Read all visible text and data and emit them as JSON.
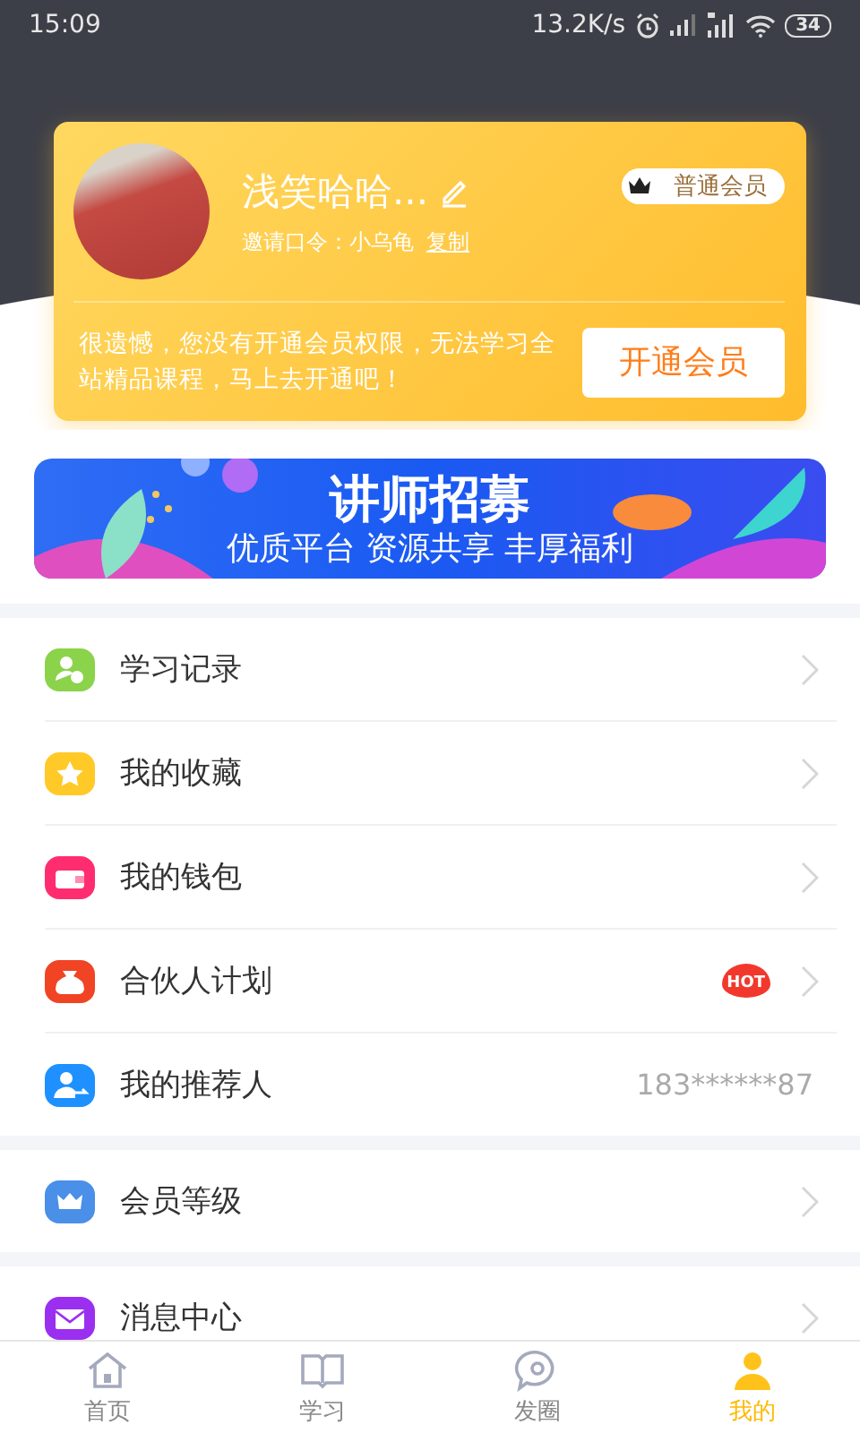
{
  "status_bar": {
    "time": "15:09",
    "speed": "13.2K/s",
    "battery": "34"
  },
  "profile_card": {
    "name": "浅笑哈哈...",
    "invite_label": "邀请口令：小乌龟",
    "copy_link": "复制",
    "member_badge": "普通会员",
    "notice": "很遗憾，您没有开通会员权限，无法学习全站精品课程，马上去开通吧！",
    "open_button": "开通会员"
  },
  "banner": {
    "title": "讲师招募",
    "subtitle": "优质平台 资源共享 丰厚福利"
  },
  "menu_groups": [
    {
      "items": [
        {
          "label": "学习记录",
          "kind": "person-plus",
          "color": "#8bd34a"
        },
        {
          "label": "我的收藏",
          "kind": "star",
          "color": "#ffc928"
        },
        {
          "label": "我的钱包",
          "kind": "wallet",
          "color": "#ff2d6f"
        },
        {
          "label": "合伙人计划",
          "kind": "bag",
          "color": "#f04424",
          "badge": "HOT"
        },
        {
          "label": "我的推荐人",
          "kind": "person-share",
          "color": "#1e90ff",
          "value": "183******87"
        }
      ]
    },
    {
      "items": [
        {
          "label": "会员等级",
          "kind": "crown",
          "color": "#4a8fe8"
        }
      ]
    },
    {
      "items": [
        {
          "label": "消息中心",
          "kind": "mail",
          "color": "#9b2ff0"
        }
      ]
    }
  ],
  "tab_bar": [
    {
      "label": "首页",
      "kind": "home",
      "selected": false
    },
    {
      "label": "学习",
      "kind": "book",
      "selected": false
    },
    {
      "label": "发圈",
      "kind": "chat",
      "selected": false
    },
    {
      "label": "我的",
      "kind": "person",
      "selected": true
    }
  ]
}
